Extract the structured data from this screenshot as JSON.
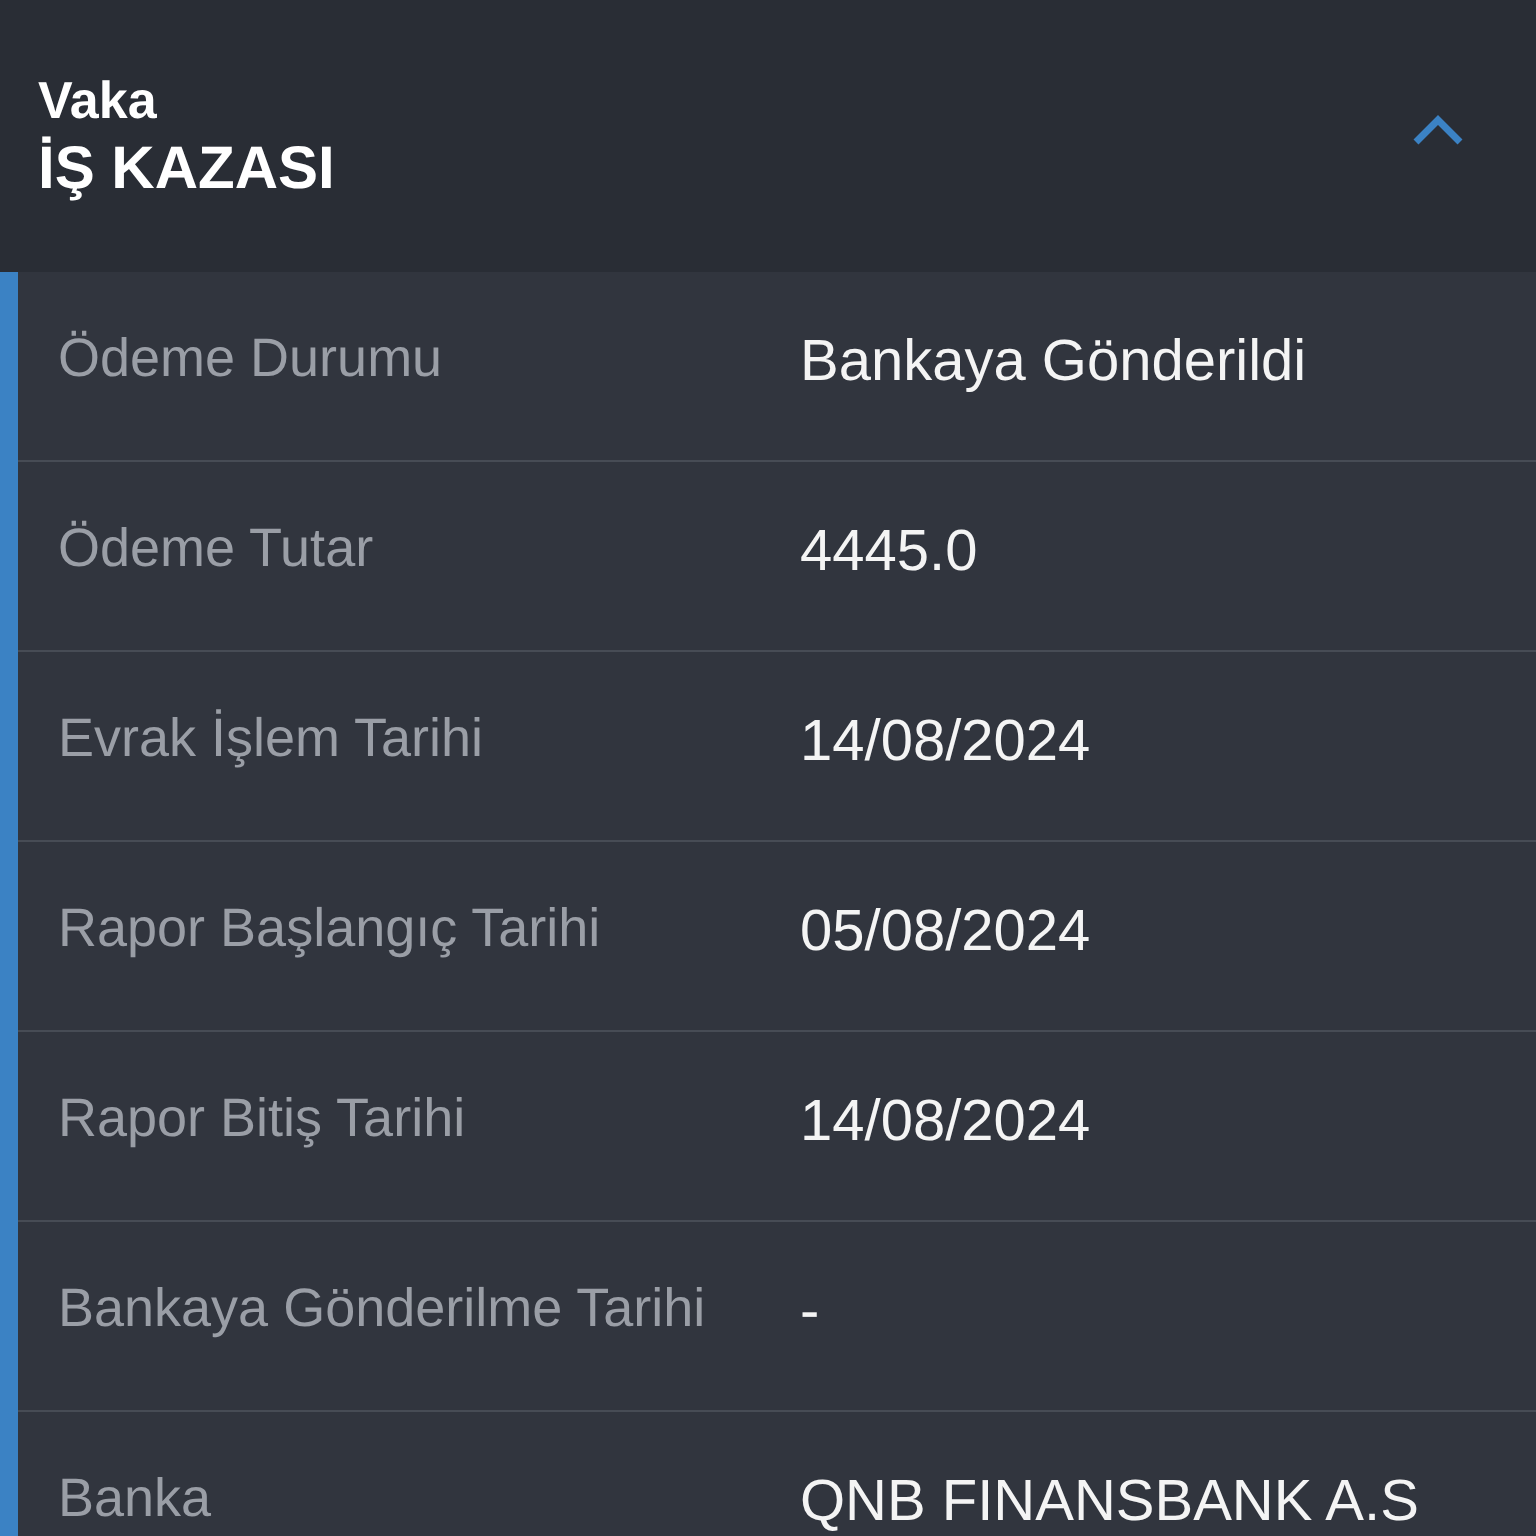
{
  "header": {
    "label": "Vaka",
    "title": "İŞ KAZASI",
    "expanded": true
  },
  "rows": [
    {
      "label": "Ödeme Durumu",
      "value": "Bankaya Gönderildi"
    },
    {
      "label": "Ödeme Tutar",
      "value": "4445.0"
    },
    {
      "label": "Evrak İşlem Tarihi",
      "value": "14/08/2024"
    },
    {
      "label": "Rapor Başlangıç Tarihi",
      "value": "05/08/2024"
    },
    {
      "label": "Rapor Bitiş Tarihi",
      "value": "14/08/2024"
    },
    {
      "label": "Bankaya Gönderilme Tarihi",
      "value": "-"
    },
    {
      "label": "Banka",
      "value": "QNB FINANSBANK A.S"
    }
  ]
}
